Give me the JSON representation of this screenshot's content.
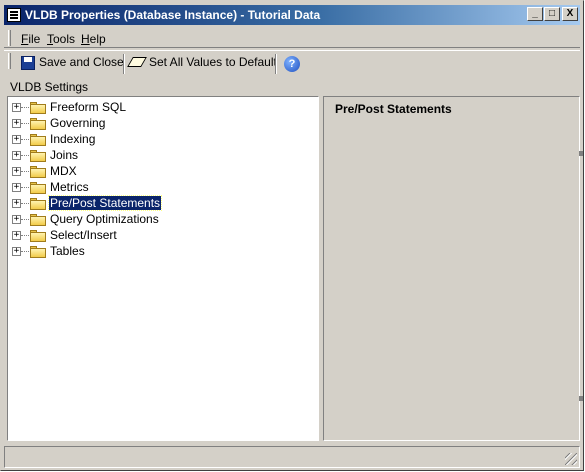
{
  "window": {
    "title": "VLDB Properties (Database Instance) - Tutorial Data"
  },
  "caption_buttons": {
    "minimize": "_",
    "maximize": "□",
    "close": "X"
  },
  "menu": {
    "items": [
      {
        "label_prefix": "F",
        "label_rest": "ile"
      },
      {
        "label_prefix": "T",
        "label_rest": "ools"
      },
      {
        "label_prefix": "H",
        "label_rest": "elp"
      }
    ]
  },
  "toolbar": {
    "save_close": "Save and Close",
    "set_default": "Set All Values to Default",
    "help_glyph": "?"
  },
  "section_label": "VLDB Settings",
  "tree": {
    "items": [
      {
        "label": "Freeform SQL"
      },
      {
        "label": "Governing"
      },
      {
        "label": "Indexing"
      },
      {
        "label": "Joins"
      },
      {
        "label": "MDX"
      },
      {
        "label": "Metrics"
      },
      {
        "label": "Pre/Post Statements"
      },
      {
        "label": "Query Optimizations"
      },
      {
        "label": "Select/Insert"
      },
      {
        "label": "Tables"
      }
    ],
    "expander_glyph": "+",
    "selected_index": 6
  },
  "detail": {
    "title": "Pre/Post Statements"
  }
}
